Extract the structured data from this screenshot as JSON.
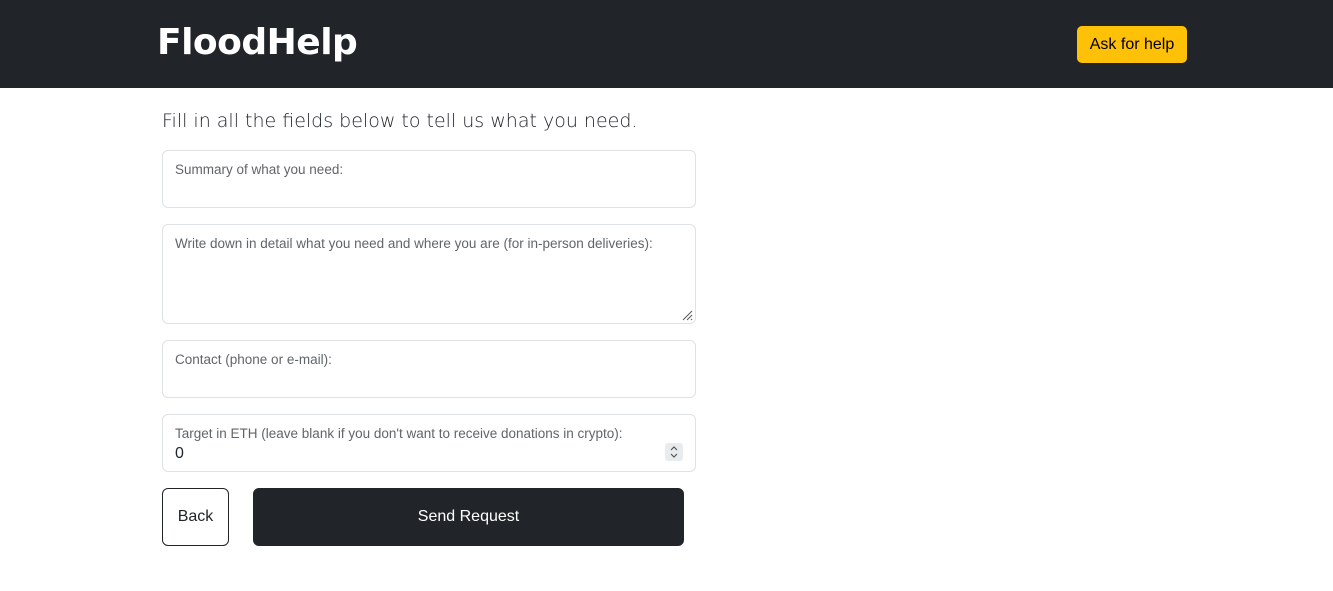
{
  "navbar": {
    "brand": "FloodHelp",
    "ask_button_label": "Ask for help",
    "background_color": "#212529",
    "accent_color": "#ffc107"
  },
  "form": {
    "intro": "Fill in all the fields below to tell us what you need.",
    "summary": {
      "label": "Summary of what you need:",
      "value": ""
    },
    "detail": {
      "label": "Write down in detail what you need and where you are (for in-person deliveries):",
      "value": ""
    },
    "contact": {
      "label": "Contact (phone or e-mail):",
      "value": ""
    },
    "target": {
      "label": "Target in ETH (leave blank if you don't want to receive donations in crypto):",
      "value": "0"
    },
    "back_label": "Back",
    "send_label": "Send Request",
    "icons": {
      "resize": "resize-grip-icon",
      "spinner": "number-spinner-icon"
    }
  }
}
